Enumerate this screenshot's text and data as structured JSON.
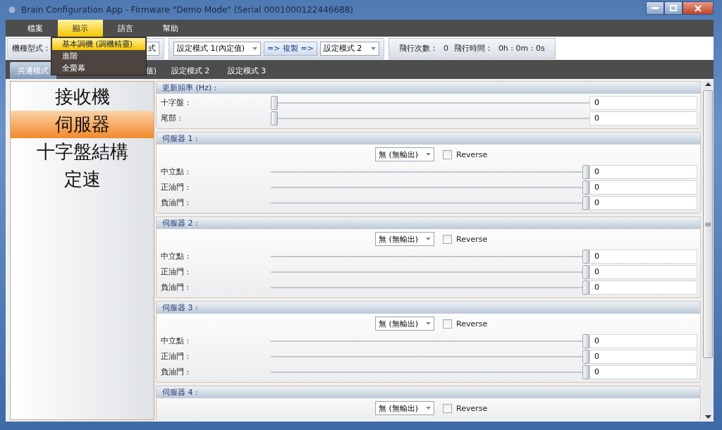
{
  "window": {
    "title": "Brain Configuration App - Firmware \"Demo Mode\" (Serial 0001000122446688)"
  },
  "menu": [
    {
      "label": "檔案",
      "selected": false
    },
    {
      "label": "顯示",
      "selected": true
    },
    {
      "label": "語言",
      "selected": false
    },
    {
      "label": "幫助",
      "selected": false
    }
  ],
  "open_menu": {
    "items": [
      {
        "label": "基本調機 (調機精靈)",
        "selected": true
      },
      {
        "label": "進階",
        "selected": false
      },
      {
        "label": "全螢幕",
        "selected": false
      }
    ]
  },
  "toolbar": {
    "model_label": "機種型式：",
    "model_value": "式",
    "source_select": "設定模式 1(內定值)",
    "copy_button": "=> 複製 =>",
    "target_select": "設定模式 2",
    "flight_count_label": "飛行次數：",
    "flight_count": "0",
    "flight_time_label": "飛行時間：",
    "flight_time": "0h : 0m : 0s"
  },
  "tabs": [
    {
      "label": "共通模式",
      "selected": true
    },
    {
      "label": "值)",
      "selected": false
    },
    {
      "label": "設定模式 2",
      "selected": false
    },
    {
      "label": "設定模式 3",
      "selected": false
    }
  ],
  "sidebar": {
    "items": [
      {
        "label": "接收機",
        "selected": false
      },
      {
        "label": "伺服器",
        "selected": true
      },
      {
        "label": "十字盤結構",
        "selected": false
      },
      {
        "label": "定速",
        "selected": false
      }
    ]
  },
  "sections": [
    {
      "kind": "rate",
      "title": "更新頻率 (Hz) :",
      "rows": [
        {
          "label": "十字盤 :",
          "level": 0,
          "value": "0"
        },
        {
          "label": "尾部 :",
          "level": 0,
          "value": "0"
        }
      ]
    },
    {
      "kind": "servo",
      "title": "伺服器 1 :",
      "output": "無 (無輸出)",
      "reverse": {
        "label": "Reverse",
        "checked": false
      },
      "rows": [
        {
          "label": "中立點 :",
          "level": 1,
          "value": "0"
        },
        {
          "label": "正油門 :",
          "level": 1,
          "value": "0"
        },
        {
          "label": "負油門 :",
          "level": 1,
          "value": "0"
        }
      ]
    },
    {
      "kind": "servo",
      "title": "伺服器 2 :",
      "output": "無 (無輸出)",
      "reverse": {
        "label": "Reverse",
        "checked": false
      },
      "rows": [
        {
          "label": "中立點 :",
          "level": 1,
          "value": "0"
        },
        {
          "label": "正油門 :",
          "level": 1,
          "value": "0"
        },
        {
          "label": "負油門 :",
          "level": 1,
          "value": "0"
        }
      ]
    },
    {
      "kind": "servo",
      "title": "伺服器 3 :",
      "output": "無 (無輸出)",
      "reverse": {
        "label": "Reverse",
        "checked": false
      },
      "rows": [
        {
          "label": "中立點 :",
          "level": 1,
          "value": "0"
        },
        {
          "label": "正油門 :",
          "level": 1,
          "value": "0"
        },
        {
          "label": "負油門 :",
          "level": 1,
          "value": "0"
        }
      ]
    },
    {
      "kind": "servo",
      "title": "伺服器 4 :",
      "output": "無 (無輸出)",
      "reverse": {
        "label": "Reverse",
        "checked": false
      }
    }
  ]
}
